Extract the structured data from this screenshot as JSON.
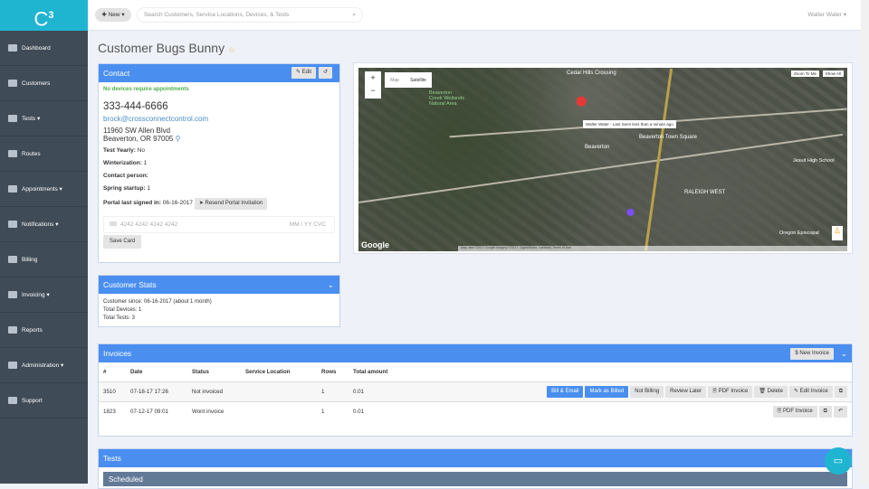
{
  "app": {
    "logo": "C",
    "logo_sup": "3"
  },
  "sidebar": {
    "items": [
      {
        "label": "Dashboard"
      },
      {
        "label": "Customers"
      },
      {
        "label": "Tests ▾"
      },
      {
        "label": "Routes"
      },
      {
        "label": "Appointments ▾"
      },
      {
        "label": "Notifications ▾"
      },
      {
        "label": "Billing"
      },
      {
        "label": "Invoicing ▾"
      },
      {
        "label": "Reports"
      },
      {
        "label": "Administration ▾"
      },
      {
        "label": "Support"
      }
    ]
  },
  "topbar": {
    "new_label": "✚ New ▾",
    "search_placeholder": "Search Customers, Service Locations, Devices, & Tests",
    "user": "Walter Water ▾"
  },
  "page": {
    "title": "Customer Bugs Bunny",
    "star": "☆"
  },
  "contact": {
    "header": "Contact",
    "edit_label": "✎ Edit",
    "history_label": "↺",
    "notice": "No devices require appointments",
    "phone": "333-444-6666",
    "email": "brock@crossconnectcontrol.com",
    "address1": "11960 SW Allen Blvd",
    "address2": "Beaverton, OR 97005",
    "fields": [
      {
        "label": "Test Yearly:",
        "value": "No"
      },
      {
        "label": "Winterization:",
        "value": "1"
      },
      {
        "label": "Contact person:",
        "value": ""
      },
      {
        "label": "Spring startup:",
        "value": "1"
      }
    ],
    "portal_label": "Portal last signed in:",
    "portal_value": "06-16-2017",
    "resend_label": "➤ Resend Portal Invitation",
    "card_placeholder": "4242 4242 4242 4242",
    "card_exp": "MM / YY  CVC",
    "save_card": "Save Card"
  },
  "stats": {
    "header": "Customer Stats",
    "lines": [
      "Customer since: 06-16-2017 (about 1 month)",
      "Total Devices: 1",
      "Total Tests: 3"
    ]
  },
  "map": {
    "map_tab": "Map",
    "satellite_tab": "Satellite",
    "zoom_to_me": "Zoom To Me",
    "show_all": "Show All",
    "tooltip": "Walter Water - Last Seen less than a minute ago",
    "labels": [
      "Cedar Hills Crossing",
      "Beaverton",
      "Beaverton Town Square",
      "RALEIGH WEST",
      "Beaverton Creek Wetlands Natural Area",
      "Jesuit High School",
      "Oregon Episcopal"
    ],
    "google": "Google",
    "attribution": "Map data ©2017 Google Imagery ©2017, DigitalGlobe, Landsat | Terms of Use"
  },
  "invoices": {
    "header": "Invoices",
    "new_label": "$ New Invoice",
    "columns": [
      "#",
      "Date",
      "Status",
      "Service Location",
      "Rows",
      "Total amount"
    ],
    "rows": [
      {
        "num": "3510",
        "date": "07-18-17 17:26",
        "status": "Not invoiced",
        "location": "",
        "rows": "1",
        "total": "0.01",
        "actions": [
          "Bill & Email",
          "Mark as Billed",
          "Not Billing",
          "Review Later",
          "🗎 PDF Invoice",
          "🗑 Delete",
          "✎ Edit Invoice",
          "⧉"
        ]
      },
      {
        "num": "1823",
        "date": "07-12-17 09:01",
        "status": "Wont invoice",
        "location": "",
        "rows": "1",
        "total": "0.01",
        "actions": [
          "🗎 PDF Invoice",
          "⧉",
          "↶"
        ]
      }
    ]
  },
  "tests": {
    "header": "Tests",
    "scheduled": "Scheduled"
  }
}
